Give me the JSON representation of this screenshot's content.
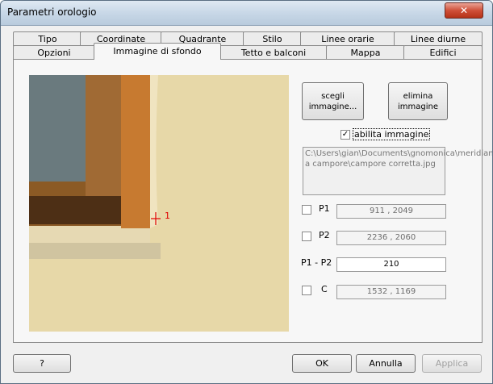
{
  "window": {
    "title": "Parametri orologio"
  },
  "tabs_row1": [
    "Tipo",
    "Coordinate",
    "Quadrante",
    "Stilo",
    "Linee orarie",
    "Linee diurne"
  ],
  "tabs_row2": [
    "Opzioni",
    "Immagine di sfondo",
    "Tetto e balconi",
    "Mappa",
    "Edifici"
  ],
  "buttons": {
    "choose": "scegli immagine...",
    "remove": "elimina immagine"
  },
  "enable_image": {
    "label": "abilita immagine",
    "checked": true
  },
  "image_path": "C:\\Users\\gian\\Documents\\gnomonica\\meridiane\\meridiana a campore\\campore corretta.jpg",
  "points": [
    {
      "label": "P1",
      "value": "911  ,  2049",
      "checked": false
    },
    {
      "label": "P2",
      "value": "2236  ,  2060",
      "checked": false
    }
  ],
  "distance": {
    "label": "P1 - P2",
    "value": "210"
  },
  "center": {
    "label": "C",
    "value": "1532  ,  1169",
    "checked": false
  },
  "marker_label": "1",
  "footer": {
    "help": "?",
    "ok": "OK",
    "cancel": "Annulla",
    "apply": "Applica"
  }
}
